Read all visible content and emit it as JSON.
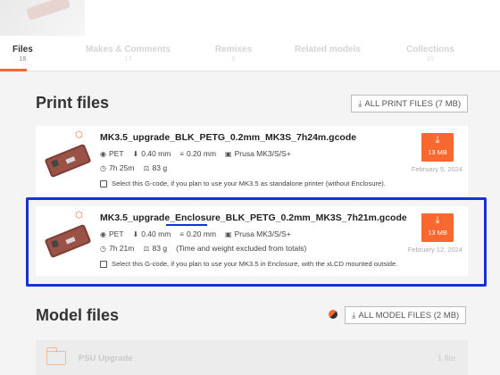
{
  "tabs": [
    {
      "label": "Files",
      "count": "18"
    },
    {
      "label": "Makes & Comments",
      "count": "17"
    },
    {
      "label": "Remixes",
      "count": "0"
    },
    {
      "label": "Related models",
      "count": ""
    },
    {
      "label": "Collections",
      "count": "33"
    }
  ],
  "print_section": {
    "title": "Print files",
    "all_button": "ALL PRINT FILES (7 MB)"
  },
  "files": [
    {
      "name": "MK3.5_upgrade_BLK_PETG_0.2mm_MK3S_7h24m.gcode",
      "material": "PET",
      "nozzle": "0.40 mm",
      "layer": "0.20 mm",
      "printer": "Prusa MK3/S/S+",
      "time": "7h 25m",
      "weight": "83 g",
      "extra": "",
      "note": "Select this G-code, if you plan to use your MK3.5 as standalone printer (without Enclosure).",
      "download_size": "13 MB",
      "date": "February 5, 2024"
    },
    {
      "name": "MK3.5_upgrade_Enclosure_BLK_PETG_0.2mm_MK3S_7h21m.gcode",
      "material": "PET",
      "nozzle": "0.40 mm",
      "layer": "0.20 mm",
      "printer": "Prusa MK3/S/S+",
      "time": "7h 21m",
      "weight": "83 g",
      "extra": "(Time and weight excluded from totals)",
      "note": "Select this G-code, if you plan to use your MK3.5 in Enclosure, with the xLCD mounted outside.",
      "download_size": "13 MB",
      "date": "February 12, 2024"
    }
  ],
  "model_section": {
    "title": "Model files",
    "all_button": "ALL MODEL FILES (2 MB)"
  },
  "folder": {
    "name": "PSU Upgrade",
    "count": "1 file"
  },
  "colors": {
    "accent": "#fa6831",
    "highlight": "#1432d6"
  }
}
